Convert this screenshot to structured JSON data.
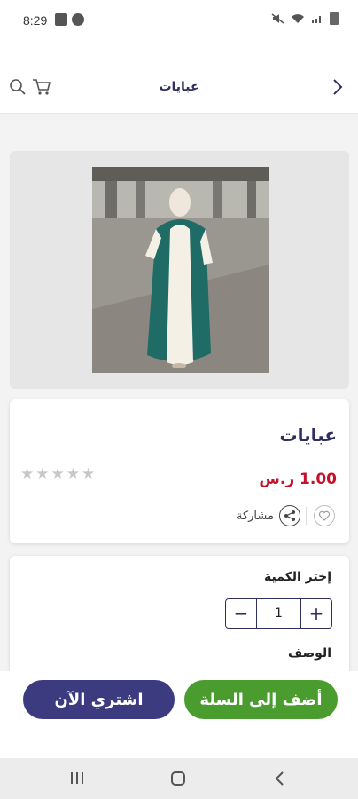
{
  "status_bar": {
    "time": "8:29"
  },
  "app_bar": {
    "title": "عبايات",
    "icons": [
      "back-arrow-icon",
      "search-icon",
      "cart-icon"
    ]
  },
  "product": {
    "name": "عبايات",
    "price": "1.00 ر.س",
    "rating_stars": 0,
    "rating_max": 5,
    "share_label": "مشاركة",
    "image_alt": "product-photo"
  },
  "quantity": {
    "label": "إختر الكمية",
    "value": "1",
    "minus": "−",
    "plus": "+"
  },
  "description": {
    "label": "الوصف"
  },
  "actions": {
    "add_to_cart": "أضف إلى السلة",
    "buy_now": "اشتري الآن"
  },
  "colors": {
    "primary": "#3d3b80",
    "add_button": "#4a9c2f",
    "price": "#c4102a",
    "title": "#2f2f5f"
  }
}
